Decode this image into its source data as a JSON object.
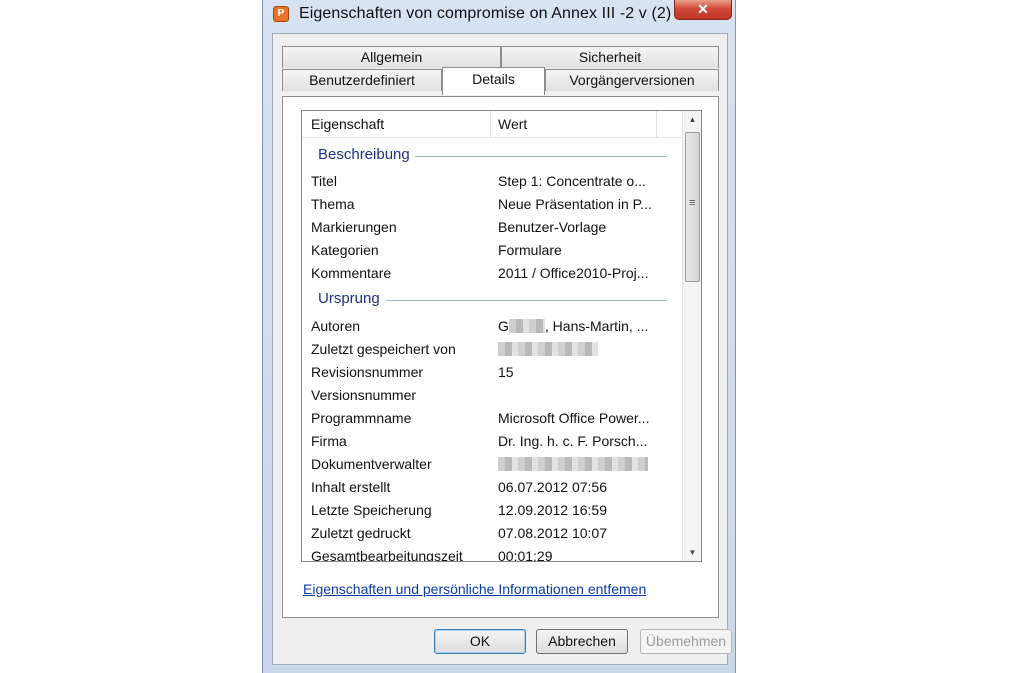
{
  "window": {
    "title": "Eigenschaften von compromise on Annex III -2 v  (2)",
    "close_label": "✕",
    "app_icon_name": "powerpoint-icon"
  },
  "tabs": {
    "row1": [
      "Allgemein",
      "Sicherheit"
    ],
    "row2": [
      "Benutzerdefiniert",
      "Details",
      "Vorgängerversionen"
    ],
    "active": "Details"
  },
  "list": {
    "col_property": "Eigenschaft",
    "col_value": "Wert",
    "groups": [
      {
        "name": "Beschreibung",
        "rows": [
          {
            "prop": "Titel",
            "value": "Step 1:  Concentrate o..."
          },
          {
            "prop": "Thema",
            "value": "Neue Präsentation in P..."
          },
          {
            "prop": "Markierungen",
            "value": "Benutzer-Vorlage"
          },
          {
            "prop": "Kategorien",
            "value": "Formulare"
          },
          {
            "prop": "Kommentare",
            "value": "2011 / Office2010-Proj..."
          }
        ]
      },
      {
        "name": "Ursprung",
        "rows": [
          {
            "prop": "Autoren",
            "value_prefix": "G",
            "value": ", Hans-Martin, ..."
          },
          {
            "prop": "Zuletzt gespeichert von",
            "value": ""
          },
          {
            "prop": "Revisionsnummer",
            "value": "15"
          },
          {
            "prop": "Versionsnummer",
            "value": ""
          },
          {
            "prop": "Programmname",
            "value": "Microsoft Office Power..."
          },
          {
            "prop": "Firma",
            "value": "Dr. Ing. h. c. F. Porsch..."
          },
          {
            "prop": "Dokumentverwalter",
            "value": ""
          },
          {
            "prop": "Inhalt erstellt",
            "value": "06.07.2012 07:56"
          },
          {
            "prop": "Letzte Speicherung",
            "value": "12.09.2012 16:59"
          },
          {
            "prop": "Zuletzt gedruckt",
            "value": "07.08.2012 10:07"
          },
          {
            "prop": "Gesamtbearbeitungszeit",
            "value": "00:01:29"
          }
        ]
      }
    ]
  },
  "link_text": "Eigenschaften und persönliche Informationen entfemen",
  "buttons": {
    "ok": "OK",
    "cancel": "Abbrechen",
    "apply": "Übemehmen"
  },
  "scrollbar": {
    "up_glyph": "▲",
    "down_glyph": "▼",
    "grip_glyph": "≡"
  }
}
